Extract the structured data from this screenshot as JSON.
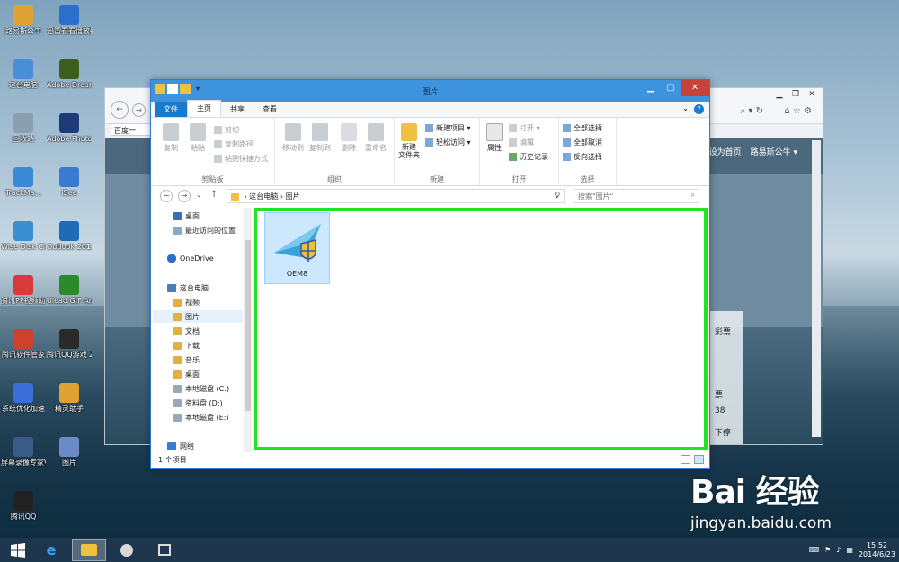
{
  "desktop": {
    "icons": [
      {
        "label": "路易斯公牛",
        "color": "#e0a232"
      },
      {
        "label": "迅雷看看播放器",
        "color": "#2a6fc9"
      },
      {
        "label": "这台电脑",
        "color": "#4a8ed8"
      },
      {
        "label": "Adobe Dreamwe...",
        "color": "#3d5e1e"
      },
      {
        "label": "回收站",
        "color": "#8aa0b0"
      },
      {
        "label": "Adobe Photosh...",
        "color": "#1e3a78"
      },
      {
        "label": "TrackMa...",
        "color": "#3a8ad8"
      },
      {
        "label": "iSee",
        "color": "#3a7ad0"
      },
      {
        "label": "Wise Disk Cleaner",
        "color": "#3a8fd0"
      },
      {
        "label": "Outlook 2013",
        "color": "#1e6bb8"
      },
      {
        "label": "腾讯PP视频助手",
        "color": "#d83a3a"
      },
      {
        "label": "Ulead GIF Animator...",
        "color": "#2a8a2a"
      },
      {
        "label": "腾讯软件管家",
        "color": "#d04030"
      },
      {
        "label": "腾讯QQ游戏 2014",
        "color": "#2a2a2a"
      },
      {
        "label": "系统优化加速",
        "color": "#3a6fd8"
      },
      {
        "label": "精灵助手",
        "color": "#e0a232"
      },
      {
        "label": "屏幕录像专家V2014",
        "color": "#3a5a8a"
      },
      {
        "label": "图片",
        "color": "#6a8ac8"
      },
      {
        "label": "腾讯QQ",
        "color": "#222222"
      }
    ]
  },
  "ie": {
    "tab_label": "百度一",
    "nav_links": [
      "设为首页",
      "路易斯公牛 ▾"
    ],
    "side_texts": [
      "彩票",
      "票",
      "38",
      "下停"
    ]
  },
  "explorer": {
    "title": "图片",
    "tabs": {
      "file": "文件",
      "home": "主页",
      "share": "共享",
      "view": "查看"
    },
    "ribbon": {
      "clipboard": {
        "group": "剪贴板",
        "copy": "复制",
        "paste": "粘贴",
        "cut": "剪切",
        "copy_path": "复制路径",
        "paste_shortcut": "粘贴快捷方式"
      },
      "organize": {
        "group": "组织",
        "move_to": "移动到",
        "copy_to": "复制到",
        "delete": "删除",
        "rename": "重命名"
      },
      "new": {
        "group": "新建",
        "new_folder": "新建\n文件夹",
        "new_item": "新建项目 ▾",
        "easy_access": "轻松访问 ▾"
      },
      "open": {
        "group": "打开",
        "properties": "属性",
        "open": "打开 ▾",
        "edit": "编辑",
        "history": "历史记录"
      },
      "select": {
        "group": "选择",
        "select_all": "全部选择",
        "select_none": "全部取消",
        "invert": "反向选择"
      }
    },
    "address": {
      "path_root": "这台电脑",
      "path_leaf": "图片",
      "search_placeholder": "搜索\"图片\""
    },
    "nav": {
      "desktop": "桌面",
      "recent": "最近访问的位置",
      "onedrive": "OneDrive",
      "this_pc": "这台电脑",
      "videos": "视频",
      "pictures": "图片",
      "documents": "文档",
      "downloads": "下载",
      "music": "音乐",
      "desktop2": "桌面",
      "disk_c": "本地磁盘 (C:)",
      "disk_d": "资料盘 (D:)",
      "disk_e": "本地磁盘 (E:)",
      "network": "网络"
    },
    "file_name": "OEM8",
    "status": "1 个项目"
  },
  "taskbar": {
    "time": "15:52",
    "date": "2014/6/23"
  },
  "watermark": {
    "brand": "Bai 经验",
    "url": "jingyan.baidu.com"
  },
  "colors": {
    "highlight_box": "#21e321",
    "title_bar": "#3d93de",
    "file_tab": "#1979ca"
  }
}
